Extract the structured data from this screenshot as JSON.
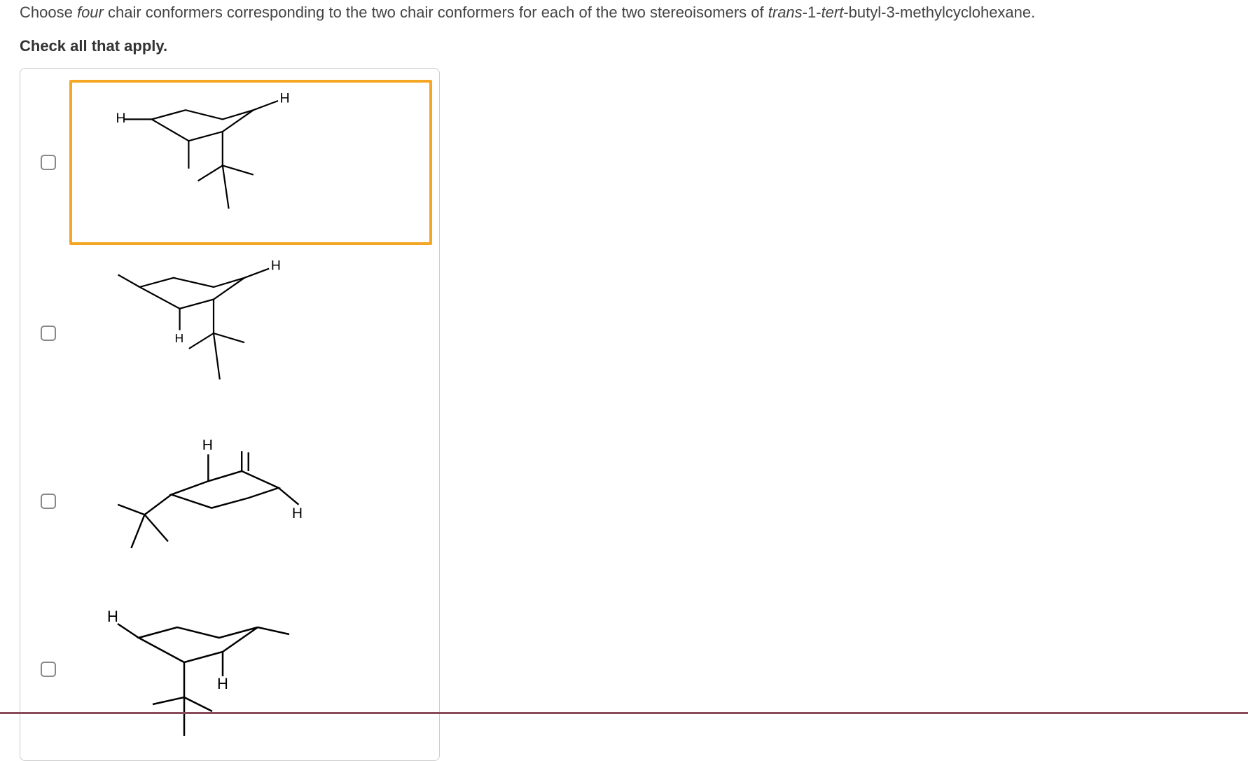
{
  "question": {
    "prefix": "Choose ",
    "four": "four",
    "middle": " chair conformers corresponding to the two chair conformers for each of the two stereoisomers of ",
    "compound_prefix": "trans",
    "compound_mid1": "-1-",
    "compound_tert": "tert",
    "compound_suffix": "-butyl-3-methylcyclohexane."
  },
  "check_all": "Check all that apply.",
  "options": [
    {
      "id": "option-1",
      "highlighted": true,
      "description": "Chair conformer 1: H equatorial left, H equatorial right-up, tert-butyl axial down-right, methyl axial down-left"
    },
    {
      "id": "option-2",
      "highlighted": false,
      "description": "Chair conformer 2: H axial down left, H equatorial right-up, tert-butyl axial down, methyl equatorial upper-left"
    },
    {
      "id": "option-3",
      "highlighted": false,
      "description": "Chair conformer 3: H axial up, H equatorial lower-right, tert-butyl equatorial lower-left, methyl axial up-right"
    },
    {
      "id": "option-4",
      "highlighted": false,
      "description": "Chair conformer 4: H equatorial upper-left, H axial down, tert-butyl axial down-left, methyl equatorial right"
    }
  ],
  "labels": {
    "H": "H"
  }
}
